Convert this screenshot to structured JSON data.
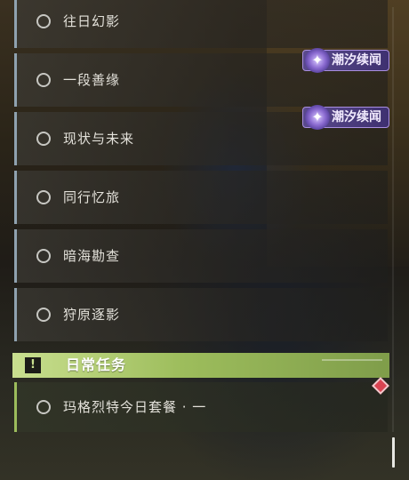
{
  "quests": [
    {
      "label": "往日幻影"
    },
    {
      "label": "一段善缘"
    },
    {
      "label": "现状与未来"
    },
    {
      "label": "同行忆旅"
    },
    {
      "label": "暗海勘查"
    },
    {
      "label": "狩原逐影"
    }
  ],
  "tags": [
    {
      "label": "潮汐续闻",
      "icon": "tidal-star-icon"
    },
    {
      "label": "潮汐续闻",
      "icon": "tidal-star-icon"
    }
  ],
  "daily_section": {
    "title": "日常任务",
    "icon": "warning-icon",
    "items": [
      {
        "label": "玛格烈特今日套餐 · 一"
      }
    ]
  },
  "colors": {
    "accent_green": "#9dbd5c",
    "tag_purple": "#5a4a8c",
    "row_border": "#8fa2b0",
    "alert_red": "#d94452"
  }
}
